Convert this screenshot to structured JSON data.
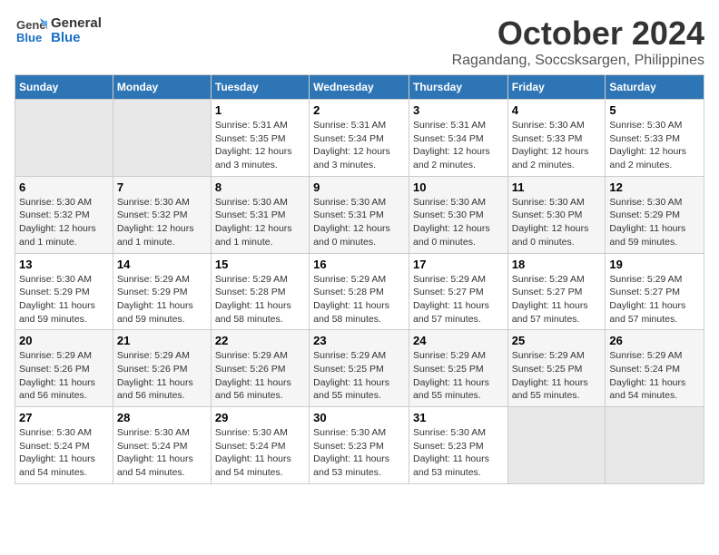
{
  "logo": {
    "general": "General",
    "blue": "Blue"
  },
  "title": "October 2024",
  "subtitle": "Ragandang, Soccsksargen, Philippines",
  "days_header": [
    "Sunday",
    "Monday",
    "Tuesday",
    "Wednesday",
    "Thursday",
    "Friday",
    "Saturday"
  ],
  "weeks": [
    [
      {
        "day": "",
        "info": ""
      },
      {
        "day": "",
        "info": ""
      },
      {
        "day": "1",
        "info": "Sunrise: 5:31 AM\nSunset: 5:35 PM\nDaylight: 12 hours\nand 3 minutes."
      },
      {
        "day": "2",
        "info": "Sunrise: 5:31 AM\nSunset: 5:34 PM\nDaylight: 12 hours\nand 3 minutes."
      },
      {
        "day": "3",
        "info": "Sunrise: 5:31 AM\nSunset: 5:34 PM\nDaylight: 12 hours\nand 2 minutes."
      },
      {
        "day": "4",
        "info": "Sunrise: 5:30 AM\nSunset: 5:33 PM\nDaylight: 12 hours\nand 2 minutes."
      },
      {
        "day": "5",
        "info": "Sunrise: 5:30 AM\nSunset: 5:33 PM\nDaylight: 12 hours\nand 2 minutes."
      }
    ],
    [
      {
        "day": "6",
        "info": "Sunrise: 5:30 AM\nSunset: 5:32 PM\nDaylight: 12 hours\nand 1 minute."
      },
      {
        "day": "7",
        "info": "Sunrise: 5:30 AM\nSunset: 5:32 PM\nDaylight: 12 hours\nand 1 minute."
      },
      {
        "day": "8",
        "info": "Sunrise: 5:30 AM\nSunset: 5:31 PM\nDaylight: 12 hours\nand 1 minute."
      },
      {
        "day": "9",
        "info": "Sunrise: 5:30 AM\nSunset: 5:31 PM\nDaylight: 12 hours\nand 0 minutes."
      },
      {
        "day": "10",
        "info": "Sunrise: 5:30 AM\nSunset: 5:30 PM\nDaylight: 12 hours\nand 0 minutes."
      },
      {
        "day": "11",
        "info": "Sunrise: 5:30 AM\nSunset: 5:30 PM\nDaylight: 12 hours\nand 0 minutes."
      },
      {
        "day": "12",
        "info": "Sunrise: 5:30 AM\nSunset: 5:29 PM\nDaylight: 11 hours\nand 59 minutes."
      }
    ],
    [
      {
        "day": "13",
        "info": "Sunrise: 5:30 AM\nSunset: 5:29 PM\nDaylight: 11 hours\nand 59 minutes."
      },
      {
        "day": "14",
        "info": "Sunrise: 5:29 AM\nSunset: 5:29 PM\nDaylight: 11 hours\nand 59 minutes."
      },
      {
        "day": "15",
        "info": "Sunrise: 5:29 AM\nSunset: 5:28 PM\nDaylight: 11 hours\nand 58 minutes."
      },
      {
        "day": "16",
        "info": "Sunrise: 5:29 AM\nSunset: 5:28 PM\nDaylight: 11 hours\nand 58 minutes."
      },
      {
        "day": "17",
        "info": "Sunrise: 5:29 AM\nSunset: 5:27 PM\nDaylight: 11 hours\nand 57 minutes."
      },
      {
        "day": "18",
        "info": "Sunrise: 5:29 AM\nSunset: 5:27 PM\nDaylight: 11 hours\nand 57 minutes."
      },
      {
        "day": "19",
        "info": "Sunrise: 5:29 AM\nSunset: 5:27 PM\nDaylight: 11 hours\nand 57 minutes."
      }
    ],
    [
      {
        "day": "20",
        "info": "Sunrise: 5:29 AM\nSunset: 5:26 PM\nDaylight: 11 hours\nand 56 minutes."
      },
      {
        "day": "21",
        "info": "Sunrise: 5:29 AM\nSunset: 5:26 PM\nDaylight: 11 hours\nand 56 minutes."
      },
      {
        "day": "22",
        "info": "Sunrise: 5:29 AM\nSunset: 5:26 PM\nDaylight: 11 hours\nand 56 minutes."
      },
      {
        "day": "23",
        "info": "Sunrise: 5:29 AM\nSunset: 5:25 PM\nDaylight: 11 hours\nand 55 minutes."
      },
      {
        "day": "24",
        "info": "Sunrise: 5:29 AM\nSunset: 5:25 PM\nDaylight: 11 hours\nand 55 minutes."
      },
      {
        "day": "25",
        "info": "Sunrise: 5:29 AM\nSunset: 5:25 PM\nDaylight: 11 hours\nand 55 minutes."
      },
      {
        "day": "26",
        "info": "Sunrise: 5:29 AM\nSunset: 5:24 PM\nDaylight: 11 hours\nand 54 minutes."
      }
    ],
    [
      {
        "day": "27",
        "info": "Sunrise: 5:30 AM\nSunset: 5:24 PM\nDaylight: 11 hours\nand 54 minutes."
      },
      {
        "day": "28",
        "info": "Sunrise: 5:30 AM\nSunset: 5:24 PM\nDaylight: 11 hours\nand 54 minutes."
      },
      {
        "day": "29",
        "info": "Sunrise: 5:30 AM\nSunset: 5:24 PM\nDaylight: 11 hours\nand 54 minutes."
      },
      {
        "day": "30",
        "info": "Sunrise: 5:30 AM\nSunset: 5:23 PM\nDaylight: 11 hours\nand 53 minutes."
      },
      {
        "day": "31",
        "info": "Sunrise: 5:30 AM\nSunset: 5:23 PM\nDaylight: 11 hours\nand 53 minutes."
      },
      {
        "day": "",
        "info": ""
      },
      {
        "day": "",
        "info": ""
      }
    ]
  ]
}
